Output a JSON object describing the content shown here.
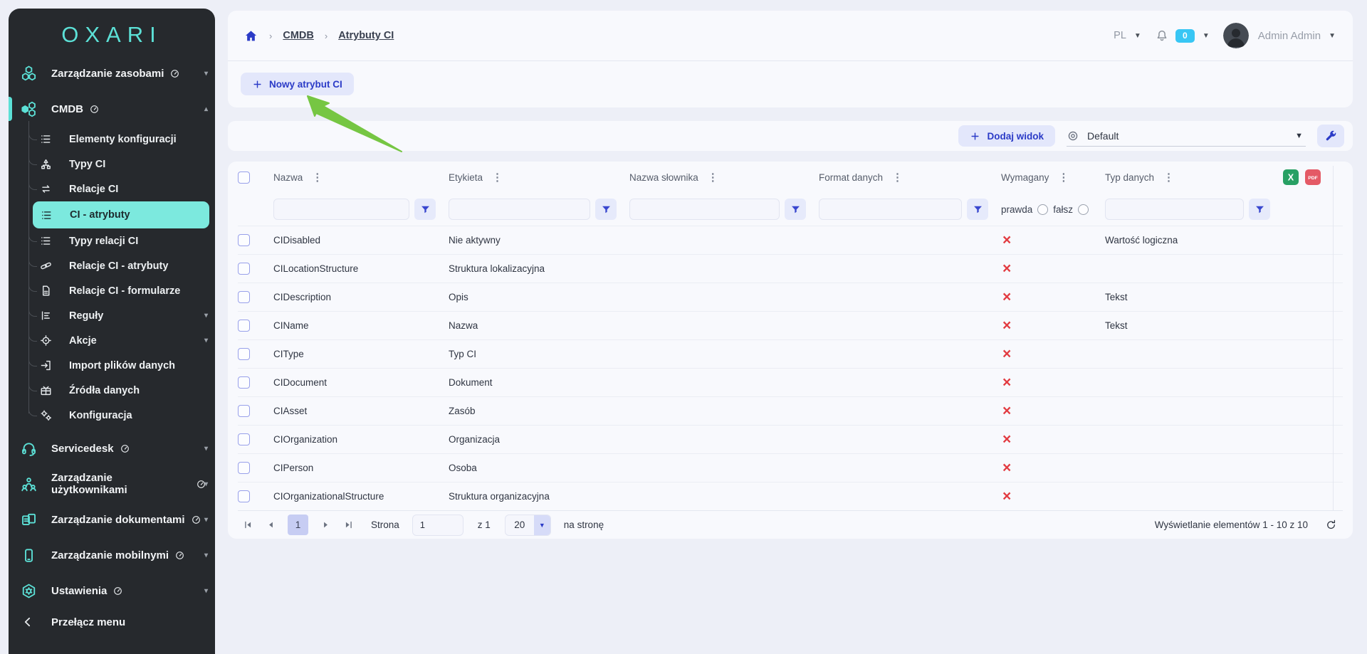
{
  "brand": {
    "logo": "OXARI"
  },
  "colors": {
    "accent_blue": "#2b3bc7",
    "accent_teal": "#5ce0d6",
    "sidebar_bg": "#26292d",
    "danger_red": "#e23b41",
    "badge_cyan": "#38c6f4",
    "excel_green": "#28a064",
    "pdf_red": "#e45a66",
    "arrow_green": "#76c643",
    "active_pill": "#7ce9de"
  },
  "sidebar": {
    "toggle_label": "Przełącz menu",
    "items": [
      {
        "id": "zarzadzanie-zasobami",
        "label": "Zarządzanie zasobami",
        "icon": "hexcluster",
        "gauge": true,
        "chevron": "down"
      },
      {
        "id": "cmdb",
        "label": "CMDB",
        "icon": "hexclusterfilled",
        "gauge": true,
        "chevron": "up",
        "active_section": true,
        "children": [
          {
            "label": "Elementy konfiguracji",
            "icon": "list"
          },
          {
            "label": "Typy CI",
            "icon": "hierarchy"
          },
          {
            "label": "Relacje CI",
            "icon": "sync"
          },
          {
            "label": "CI - atrybuty",
            "icon": "list",
            "active": true
          },
          {
            "label": "Typy relacji CI",
            "icon": "list"
          },
          {
            "label": "Relacje CI - atrybuty",
            "icon": "link"
          },
          {
            "label": "Relacje CI - formularze",
            "icon": "document"
          },
          {
            "label": "Reguły",
            "icon": "rules",
            "chevron": "down"
          },
          {
            "label": "Akcje",
            "icon": "target",
            "chevron": "down"
          },
          {
            "label": "Import plików danych",
            "icon": "import"
          },
          {
            "label": "Źródła danych",
            "icon": "datasource"
          },
          {
            "label": "Konfiguracja",
            "icon": "gears"
          }
        ]
      },
      {
        "id": "servicedesk",
        "label": "Servicedesk",
        "icon": "headset",
        "gauge": true,
        "chevron": "down"
      },
      {
        "id": "zarzadzanie-uzytkownikami",
        "label": "Zarządzanie użytkownikami",
        "icon": "users",
        "gauge": true,
        "chevron": "down"
      },
      {
        "id": "zarzadzanie-dokumentami",
        "label": "Zarządzanie dokumentami",
        "icon": "documents",
        "gauge": true,
        "chevron": "down"
      },
      {
        "id": "zarzadzanie-mobilnymi",
        "label": "Zarządzanie mobilnymi",
        "icon": "mobile",
        "gauge": true,
        "chevron": "down"
      },
      {
        "id": "ustawienia",
        "label": "Ustawienia",
        "icon": "settings",
        "gauge": true,
        "chevron": "down"
      }
    ]
  },
  "breadcrumb": {
    "items": [
      "CMDB",
      "Atrybuty CI"
    ]
  },
  "topbar": {
    "language": "PL",
    "notification_count": "0",
    "user_name": "Admin Admin"
  },
  "page_actions": {
    "new_attribute_label": "Nowy atrybut CI"
  },
  "toolbar": {
    "add_view_label": "Dodaj widok",
    "view_selected": "Default"
  },
  "table": {
    "columns": [
      {
        "label": "Nazwa",
        "filter": "input"
      },
      {
        "label": "Etykieta",
        "filter": "input"
      },
      {
        "label": "Nazwa słownika",
        "filter": "input"
      },
      {
        "label": "Format danych",
        "filter": "input"
      },
      {
        "label": "Wymagany",
        "filter": "radio"
      },
      {
        "label": "Typ danych",
        "filter": "input"
      }
    ],
    "radio_filter": {
      "true_label": "prawda",
      "false_label": "fałsz"
    },
    "rows": [
      {
        "nazwa": "CIDisabled",
        "etykieta": "Nie aktywny",
        "nazwa_slownika": "",
        "format_danych": "",
        "wymagany": false,
        "typ_danych": "Wartość logiczna"
      },
      {
        "nazwa": "CILocationStructure",
        "etykieta": "Struktura lokalizacyjna",
        "nazwa_slownika": "",
        "format_danych": "",
        "wymagany": false,
        "typ_danych": ""
      },
      {
        "nazwa": "CIDescription",
        "etykieta": "Opis",
        "nazwa_slownika": "",
        "format_danych": "",
        "wymagany": false,
        "typ_danych": "Tekst"
      },
      {
        "nazwa": "CIName",
        "etykieta": "Nazwa",
        "nazwa_slownika": "",
        "format_danych": "",
        "wymagany": false,
        "typ_danych": "Tekst"
      },
      {
        "nazwa": "CIType",
        "etykieta": "Typ CI",
        "nazwa_slownika": "",
        "format_danych": "",
        "wymagany": false,
        "typ_danych": ""
      },
      {
        "nazwa": "CIDocument",
        "etykieta": "Dokument",
        "nazwa_slownika": "",
        "format_danych": "",
        "wymagany": false,
        "typ_danych": ""
      },
      {
        "nazwa": "CIAsset",
        "etykieta": "Zasób",
        "nazwa_slownika": "",
        "format_danych": "",
        "wymagany": false,
        "typ_danych": ""
      },
      {
        "nazwa": "CIOrganization",
        "etykieta": "Organizacja",
        "nazwa_slownika": "",
        "format_danych": "",
        "wymagany": false,
        "typ_danych": ""
      },
      {
        "nazwa": "CIPerson",
        "etykieta": "Osoba",
        "nazwa_slownika": "",
        "format_danych": "",
        "wymagany": false,
        "typ_danych": ""
      },
      {
        "nazwa": "CIOrganizationalStructure",
        "etykieta": "Struktura organizacyjna",
        "nazwa_slownika": "",
        "format_danych": "",
        "wymagany": false,
        "typ_danych": ""
      }
    ]
  },
  "pagination": {
    "current_page": "1",
    "page_label": "Strona",
    "page_input": "1",
    "of_label": "z 1",
    "page_size": "20",
    "per_page_label": "na stronę",
    "summary": "Wyświetlanie elementów 1 - 10 z 10"
  }
}
